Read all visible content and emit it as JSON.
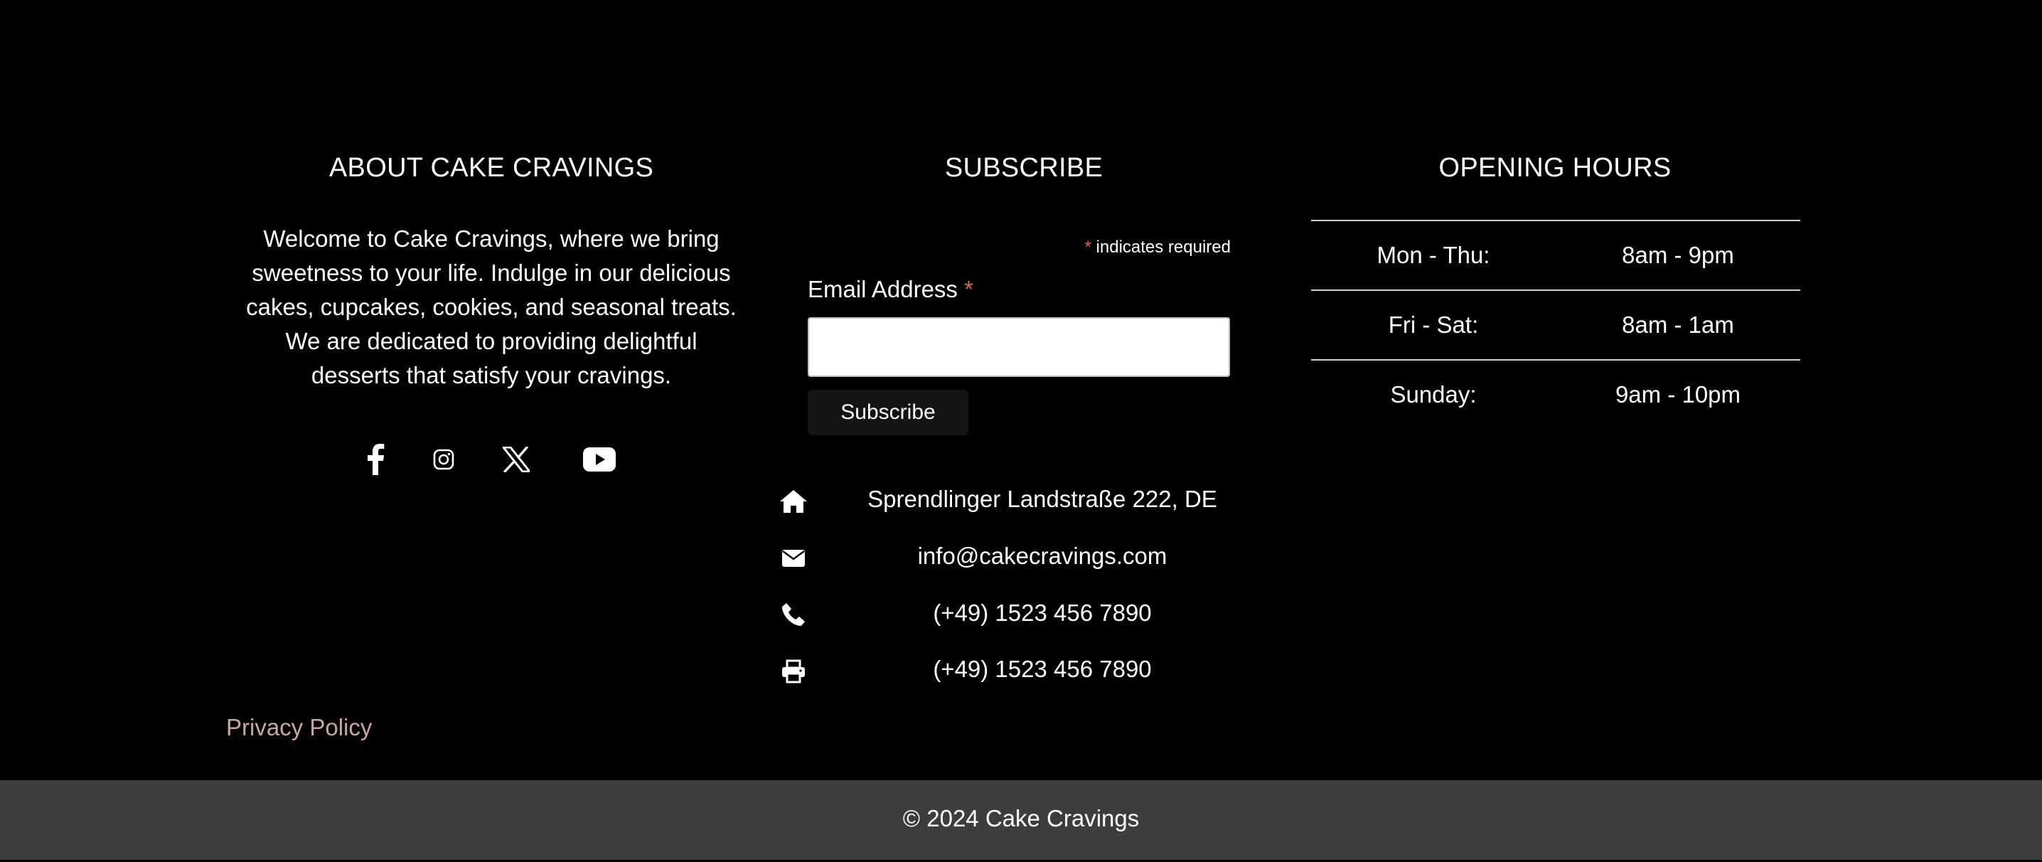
{
  "about": {
    "heading": "ABOUT CAKE CRAVINGS",
    "text": "Welcome to Cake Cravings, where we bring sweetness to your life. Indulge in our delicious cakes, cupcakes, cookies, and seasonal treats. We are dedicated to providing delightful desserts that satisfy your cravings.",
    "social_icons": [
      "facebook-icon",
      "instagram-icon",
      "x-icon",
      "youtube-icon"
    ]
  },
  "subscribe": {
    "heading": "SUBSCRIBE",
    "required_asterisk": "*",
    "required_note": " indicates required",
    "email_label": "Email Address",
    "email_asterisk": "*",
    "email_value": "",
    "button_label": "Subscribe"
  },
  "contact": {
    "address": "Sprendlinger Landstraße 222, DE",
    "email": "info@cakecravings.com",
    "phone": "(+49) 1523 456 7890",
    "fax": "(+49) 1523 456 7890",
    "icons": [
      "home-icon",
      "envelope-icon",
      "phone-icon",
      "printer-icon"
    ]
  },
  "hours": {
    "heading": "OPENING HOURS",
    "rows": [
      {
        "day": "Mon - Thu:",
        "time": "8am - 9pm"
      },
      {
        "day": "Fri - Sat:",
        "time": "8am - 1am"
      },
      {
        "day": "Sunday:",
        "time": "9am - 10pm"
      }
    ]
  },
  "footer": {
    "privacy_link": "Privacy Policy",
    "copyright": "© 2024 Cake Cravings"
  },
  "colors": {
    "background": "#000000",
    "footer_bar": "#3d3d3d",
    "link": "#c9a79e",
    "required_asterisk": "#e0664d"
  }
}
